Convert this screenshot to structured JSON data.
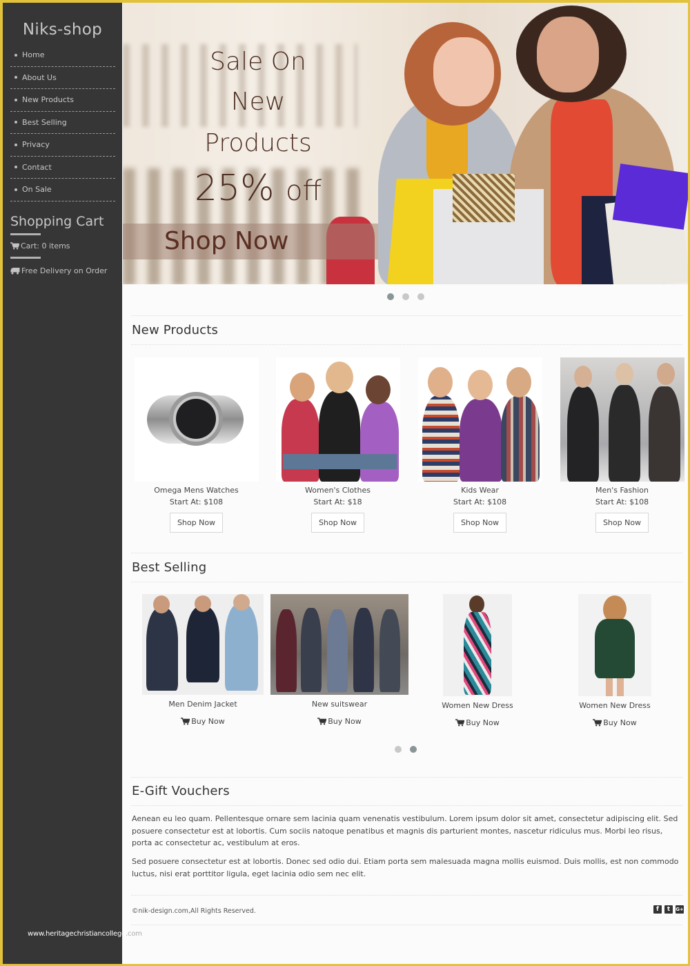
{
  "sidebar": {
    "logo": "Niks-shop",
    "nav": [
      "Home",
      "About Us",
      "New Products",
      "Best Selling",
      "Privacy",
      "Contact",
      "On Sale"
    ],
    "cart_title": "Shopping Cart",
    "cart_text": "Cart: 0 items",
    "delivery_text": "Free Delivery on Order",
    "watermark": "www.heritagechristiancollege",
    "watermark_tail": ".com"
  },
  "hero": {
    "line1": "Sale On",
    "line2": "New Products",
    "discount": "25%",
    "discount_suffix": "off",
    "cta": "Shop Now",
    "slide_count": 3,
    "active_slide": 1
  },
  "new_products": {
    "title": "New Products",
    "items": [
      {
        "name": "Omega Mens Watches",
        "price": "Start At: $108",
        "button": "Shop Now"
      },
      {
        "name": "Women's Clothes",
        "price": "Start At: $18",
        "button": "Shop Now"
      },
      {
        "name": "Kids Wear",
        "price": "Start At: $108",
        "button": "Shop Now"
      },
      {
        "name": "Men's Fashion",
        "price": "Start At: $108",
        "button": "Shop Now"
      }
    ]
  },
  "best_selling": {
    "title": "Best Selling",
    "items": [
      {
        "name": "Men Denim Jacket",
        "button": "Buy Now"
      },
      {
        "name": "New suitswear",
        "button": "Buy Now"
      },
      {
        "name": "Women New Dress",
        "button": "Buy Now"
      },
      {
        "name": "Women New Dress",
        "button": "Buy Now"
      }
    ],
    "page_count": 2,
    "active_page": 2
  },
  "vouchers": {
    "title": "E-Gift Vouchers",
    "paragraphs": [
      "Aenean eu leo quam. Pellentesque ornare sem lacinia quam venenatis vestibulum. Lorem ipsum dolor sit amet, consectetur adipiscing elit. Sed posuere consectetur est at lobortis. Cum sociis natoque penatibus et magnis dis parturient montes, nascetur ridiculus mus. Morbi leo risus, porta ac consectetur ac, vestibulum at eros.",
      "Sed posuere consectetur est at lobortis. Donec sed odio dui. Etiam porta sem malesuada magna mollis euismod. Duis mollis, est non commodo luctus, nisi erat porttitor ligula, eget lacinia odio sem nec elit."
    ]
  },
  "footer": {
    "copyright": "©nik-design.com,All Rights Reserved.",
    "social": [
      {
        "icon": "facebook-icon",
        "glyph": "f"
      },
      {
        "icon": "twitter-icon",
        "glyph": "t"
      },
      {
        "icon": "google-plus-icon",
        "glyph": "G+"
      }
    ]
  },
  "colors": {
    "frame": "#e2c23a",
    "sidebar_bg": "#363636",
    "hero_text": "#4e2e22",
    "dot_active": "#8a9596",
    "dot_inactive": "#c8c8c8"
  }
}
